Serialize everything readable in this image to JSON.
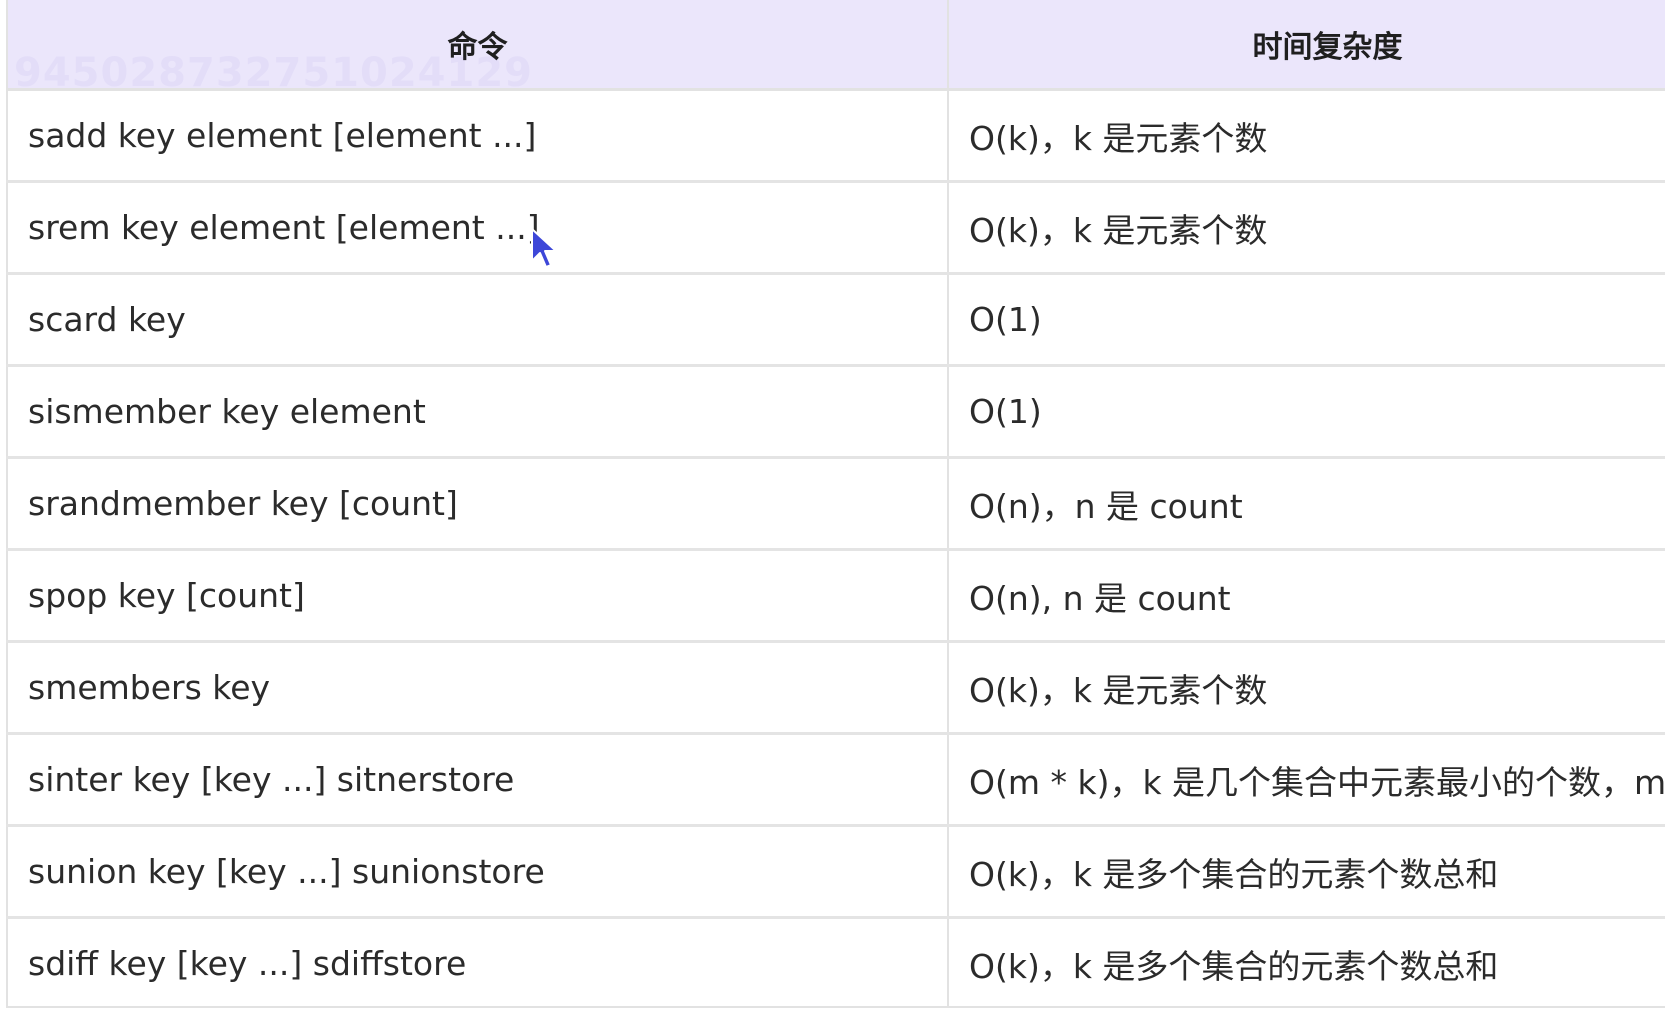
{
  "table": {
    "headers": [
      "命令",
      "时间复杂度"
    ],
    "watermark": "9450287327510241​29",
    "rows": [
      {
        "command": "sadd key element [element ...]",
        "complexity": "O(k)，k 是元素个数"
      },
      {
        "command": "srem key element [element ...]",
        "complexity": "O(k)，k 是元素个数"
      },
      {
        "command": "scard key",
        "complexity": "O(1)"
      },
      {
        "command": "sismember key element",
        "complexity": "O(1)"
      },
      {
        "command": "srandmember key [count]",
        "complexity": "O(n)，n 是 count"
      },
      {
        "command": "spop key [count]",
        "complexity": "O(n), n 是 count"
      },
      {
        "command": "smembers key",
        "complexity": "O(k)，k 是元素个数"
      },
      {
        "command": "sinter key [key ...]   sitnerstore",
        "complexity": "O(m * k)，k 是几个集合中元素最小的个数，m 是"
      },
      {
        "command": "sunion key [key ...]  sunionstore",
        "complexity": "O(k)，k 是多个集合的元素个数总和"
      },
      {
        "command": "sdiff key [key ...]   sdiffstore",
        "complexity": "O(k)，k 是多个集合的元素个数总和"
      }
    ]
  },
  "colors": {
    "header_bg": "#ebe6fb",
    "border": "#e2e2e2",
    "text": "#2b2b2b",
    "cursor": "#3d47d8"
  },
  "icons": {
    "cursor": "mouse-pointer-icon"
  }
}
